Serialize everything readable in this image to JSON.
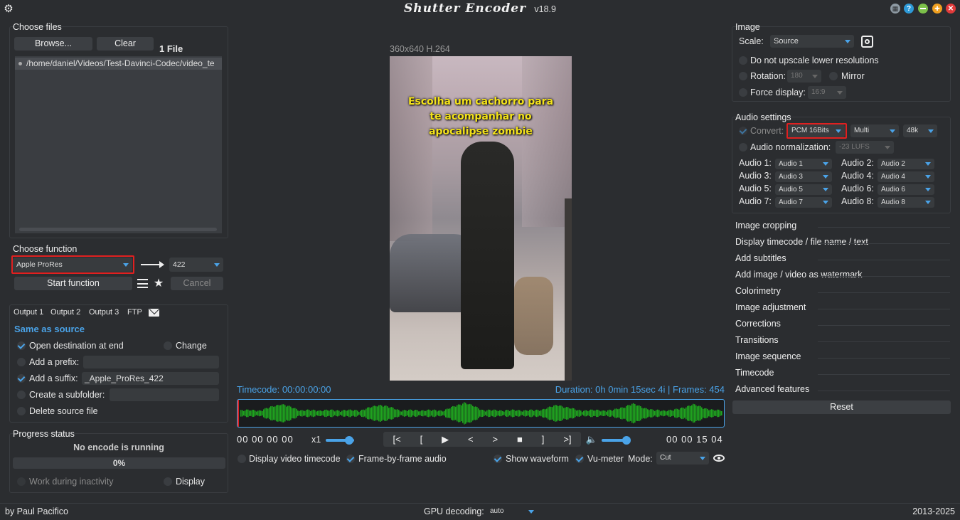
{
  "app": {
    "title": "Shutter Encoder",
    "version": "v18.9"
  },
  "files": {
    "header": "Choose files",
    "browse_label": "Browse...",
    "clear_label": "Clear",
    "count_label": "1 File",
    "items": [
      "/home/daniel/Videos/Test-Davinci-Codec/video_te"
    ]
  },
  "function": {
    "header": "Choose function",
    "selected": "Apple ProRes",
    "profile": "422",
    "start_label": "Start function",
    "cancel_label": "Cancel"
  },
  "output": {
    "tabs": [
      "Output 1",
      "Output 2",
      "Output 3",
      "FTP"
    ],
    "destination": "Same as source",
    "open_dest_label": "Open destination at end",
    "change_label": "Change",
    "prefix_label": "Add a prefix:",
    "suffix_label": "Add a suffix:",
    "suffix_value": "_Apple_ProRes_422",
    "subfolder_label": "Create a subfolder:",
    "delete_label": "Delete source file"
  },
  "progress": {
    "header": "Progress status",
    "status": "No encode is running",
    "percent": "0%",
    "work_inactivity_label": "Work during inactivity",
    "display_label": "Display"
  },
  "preview": {
    "info": "360x640 H.264",
    "caption": [
      "Escolha um cachorro para",
      "te acompanhar no",
      "apocalipse zombie"
    ],
    "timecode_label": "Timecode: 00:00:00:00",
    "duration_label": "Duration: 0h 0min 15sec 4i | Frames: 454",
    "tc_in": "00 00 00 00",
    "speed": "x1",
    "transport": [
      "[<",
      "[",
      "▶",
      "<",
      ">",
      "■",
      "]",
      ">]"
    ],
    "tc_out": "00 00 15 04",
    "display_tc_label": "Display video timecode",
    "frame_audio_label": "Frame-by-frame audio",
    "show_waveform_label": "Show waveform",
    "vumeter_label": "Vu-meter",
    "mode_label": "Mode:",
    "mode_value": "Cut"
  },
  "image": {
    "header": "Image",
    "scale_label": "Scale:",
    "scale_value": "Source",
    "no_upscale_label": "Do not upscale lower resolutions",
    "rotation_label": "Rotation:",
    "rotation_value": "180",
    "mirror_label": "Mirror",
    "force_display_label": "Force display:",
    "force_display_value": "16:9"
  },
  "audio": {
    "header": "Audio settings",
    "convert_label": "Convert:",
    "codec": "PCM 16Bits",
    "channels": "Multi",
    "rate": "48k",
    "normalization_label": "Audio normalization:",
    "normalization_value": "-23 LUFS",
    "tracks": [
      {
        "label": "Audio 1:",
        "value": "Audio 1"
      },
      {
        "label": "Audio 2:",
        "value": "Audio 2"
      },
      {
        "label": "Audio 3:",
        "value": "Audio 3"
      },
      {
        "label": "Audio 4:",
        "value": "Audio 4"
      },
      {
        "label": "Audio 5:",
        "value": "Audio 5"
      },
      {
        "label": "Audio 6:",
        "value": "Audio 6"
      },
      {
        "label": "Audio 7:",
        "value": "Audio 7"
      },
      {
        "label": "Audio 8:",
        "value": "Audio 8"
      }
    ]
  },
  "sections": [
    "Image cropping",
    "Display timecode / file name / text",
    "Add subtitles",
    "Add image / video as watermark",
    "Colorimetry",
    "Image adjustment",
    "Corrections",
    "Transitions",
    "Image sequence",
    "Timecode",
    "Advanced features"
  ],
  "reset_label": "Reset",
  "footer": {
    "author": "by Paul Pacifico",
    "gpu_label": "GPU decoding:",
    "gpu_value": "auto",
    "years": "2013-2025"
  },
  "colors": {
    "accent": "#4aa3e8",
    "highlight": "#e02020",
    "waveform": "#1fa51f",
    "background": "#2b2d30"
  }
}
